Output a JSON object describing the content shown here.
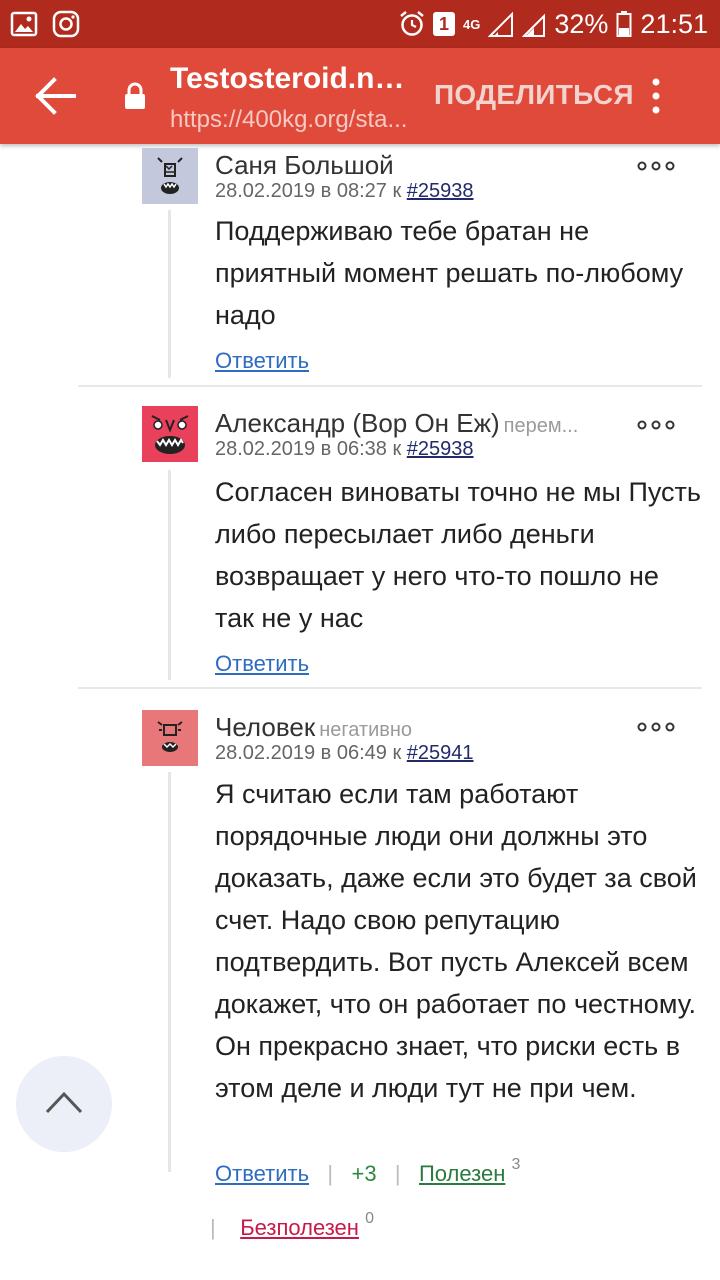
{
  "status_bar": {
    "icons_left": [
      "image-icon",
      "instagram-icon"
    ],
    "notification_count": "1",
    "network": "4G",
    "battery": "32%",
    "time": "21:51"
  },
  "toolbar": {
    "title": "Testosteroid.ne...",
    "url": "https://400kg.org/sta...",
    "share_label": "ПОДЕЛИТЬСЯ"
  },
  "comments": [
    {
      "author": "Саня Большой",
      "tag": "",
      "date": "28.02.2019 в 08:27 к",
      "ref": "#25938",
      "text": "Поддерживаю тебе братан не приятный момент решать по-любому надо",
      "reply_label": "Ответить"
    },
    {
      "author": "Александр (Вор Он Еж)",
      "tag": "перем...",
      "date": "28.02.2019 в 06:38 к",
      "ref": "#25938",
      "text": "Согласен виноваты точно не мы Пусть либо пересылает либо деньги возвращает у него что-то пошло не так не у нас",
      "reply_label": "Ответить"
    },
    {
      "author": "Человек",
      "tag": "негативно",
      "date": "28.02.2019 в 06:49 к",
      "ref": "#25941",
      "text": "Я считаю если там работают порядочные люди они должны это доказать, даже если это будет за свой счет. Надо свою репутацию подтвердить. Вот пусть Алексей всем докажет, что он работает по честному. Он прекрасно знает, что риски есть в этом деле и люди тут не при чем.",
      "reply_label": "Ответить",
      "score": "+3",
      "useful_label": "Полезен",
      "useful_count": "3",
      "useless_label": "Безполезен",
      "useless_count": "0"
    }
  ],
  "colors": {
    "status_bar": "#b02a1d",
    "toolbar": "#e04a3a",
    "link": "#2d6cc0",
    "useful": "#2b7a3e",
    "useless": "#c8194b"
  }
}
